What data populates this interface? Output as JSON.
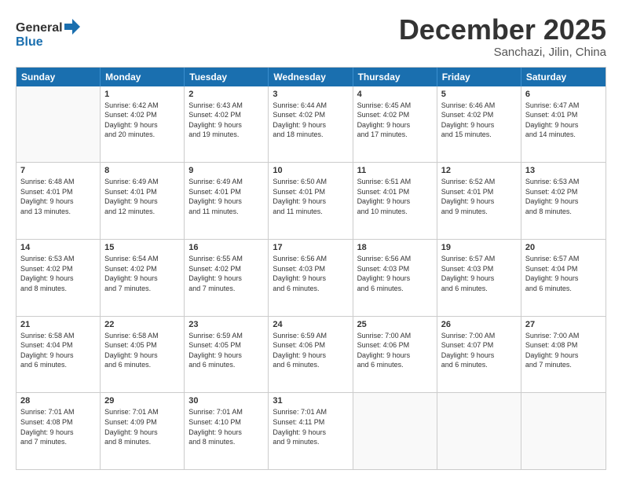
{
  "logo": {
    "line1": "General",
    "line2": "Blue"
  },
  "title": "December 2025",
  "location": "Sanchazi, Jilin, China",
  "days_of_week": [
    "Sunday",
    "Monday",
    "Tuesday",
    "Wednesday",
    "Thursday",
    "Friday",
    "Saturday"
  ],
  "weeks": [
    [
      {
        "day": "",
        "lines": []
      },
      {
        "day": "1",
        "lines": [
          "Sunrise: 6:42 AM",
          "Sunset: 4:02 PM",
          "Daylight: 9 hours",
          "and 20 minutes."
        ]
      },
      {
        "day": "2",
        "lines": [
          "Sunrise: 6:43 AM",
          "Sunset: 4:02 PM",
          "Daylight: 9 hours",
          "and 19 minutes."
        ]
      },
      {
        "day": "3",
        "lines": [
          "Sunrise: 6:44 AM",
          "Sunset: 4:02 PM",
          "Daylight: 9 hours",
          "and 18 minutes."
        ]
      },
      {
        "day": "4",
        "lines": [
          "Sunrise: 6:45 AM",
          "Sunset: 4:02 PM",
          "Daylight: 9 hours",
          "and 17 minutes."
        ]
      },
      {
        "day": "5",
        "lines": [
          "Sunrise: 6:46 AM",
          "Sunset: 4:02 PM",
          "Daylight: 9 hours",
          "and 15 minutes."
        ]
      },
      {
        "day": "6",
        "lines": [
          "Sunrise: 6:47 AM",
          "Sunset: 4:01 PM",
          "Daylight: 9 hours",
          "and 14 minutes."
        ]
      }
    ],
    [
      {
        "day": "7",
        "lines": [
          "Sunrise: 6:48 AM",
          "Sunset: 4:01 PM",
          "Daylight: 9 hours",
          "and 13 minutes."
        ]
      },
      {
        "day": "8",
        "lines": [
          "Sunrise: 6:49 AM",
          "Sunset: 4:01 PM",
          "Daylight: 9 hours",
          "and 12 minutes."
        ]
      },
      {
        "day": "9",
        "lines": [
          "Sunrise: 6:49 AM",
          "Sunset: 4:01 PM",
          "Daylight: 9 hours",
          "and 11 minutes."
        ]
      },
      {
        "day": "10",
        "lines": [
          "Sunrise: 6:50 AM",
          "Sunset: 4:01 PM",
          "Daylight: 9 hours",
          "and 11 minutes."
        ]
      },
      {
        "day": "11",
        "lines": [
          "Sunrise: 6:51 AM",
          "Sunset: 4:01 PM",
          "Daylight: 9 hours",
          "and 10 minutes."
        ]
      },
      {
        "day": "12",
        "lines": [
          "Sunrise: 6:52 AM",
          "Sunset: 4:01 PM",
          "Daylight: 9 hours",
          "and 9 minutes."
        ]
      },
      {
        "day": "13",
        "lines": [
          "Sunrise: 6:53 AM",
          "Sunset: 4:02 PM",
          "Daylight: 9 hours",
          "and 8 minutes."
        ]
      }
    ],
    [
      {
        "day": "14",
        "lines": [
          "Sunrise: 6:53 AM",
          "Sunset: 4:02 PM",
          "Daylight: 9 hours",
          "and 8 minutes."
        ]
      },
      {
        "day": "15",
        "lines": [
          "Sunrise: 6:54 AM",
          "Sunset: 4:02 PM",
          "Daylight: 9 hours",
          "and 7 minutes."
        ]
      },
      {
        "day": "16",
        "lines": [
          "Sunrise: 6:55 AM",
          "Sunset: 4:02 PM",
          "Daylight: 9 hours",
          "and 7 minutes."
        ]
      },
      {
        "day": "17",
        "lines": [
          "Sunrise: 6:56 AM",
          "Sunset: 4:03 PM",
          "Daylight: 9 hours",
          "and 6 minutes."
        ]
      },
      {
        "day": "18",
        "lines": [
          "Sunrise: 6:56 AM",
          "Sunset: 4:03 PM",
          "Daylight: 9 hours",
          "and 6 minutes."
        ]
      },
      {
        "day": "19",
        "lines": [
          "Sunrise: 6:57 AM",
          "Sunset: 4:03 PM",
          "Daylight: 9 hours",
          "and 6 minutes."
        ]
      },
      {
        "day": "20",
        "lines": [
          "Sunrise: 6:57 AM",
          "Sunset: 4:04 PM",
          "Daylight: 9 hours",
          "and 6 minutes."
        ]
      }
    ],
    [
      {
        "day": "21",
        "lines": [
          "Sunrise: 6:58 AM",
          "Sunset: 4:04 PM",
          "Daylight: 9 hours",
          "and 6 minutes."
        ]
      },
      {
        "day": "22",
        "lines": [
          "Sunrise: 6:58 AM",
          "Sunset: 4:05 PM",
          "Daylight: 9 hours",
          "and 6 minutes."
        ]
      },
      {
        "day": "23",
        "lines": [
          "Sunrise: 6:59 AM",
          "Sunset: 4:05 PM",
          "Daylight: 9 hours",
          "and 6 minutes."
        ]
      },
      {
        "day": "24",
        "lines": [
          "Sunrise: 6:59 AM",
          "Sunset: 4:06 PM",
          "Daylight: 9 hours",
          "and 6 minutes."
        ]
      },
      {
        "day": "25",
        "lines": [
          "Sunrise: 7:00 AM",
          "Sunset: 4:06 PM",
          "Daylight: 9 hours",
          "and 6 minutes."
        ]
      },
      {
        "day": "26",
        "lines": [
          "Sunrise: 7:00 AM",
          "Sunset: 4:07 PM",
          "Daylight: 9 hours",
          "and 6 minutes."
        ]
      },
      {
        "day": "27",
        "lines": [
          "Sunrise: 7:00 AM",
          "Sunset: 4:08 PM",
          "Daylight: 9 hours",
          "and 7 minutes."
        ]
      }
    ],
    [
      {
        "day": "28",
        "lines": [
          "Sunrise: 7:01 AM",
          "Sunset: 4:08 PM",
          "Daylight: 9 hours",
          "and 7 minutes."
        ]
      },
      {
        "day": "29",
        "lines": [
          "Sunrise: 7:01 AM",
          "Sunset: 4:09 PM",
          "Daylight: 9 hours",
          "and 8 minutes."
        ]
      },
      {
        "day": "30",
        "lines": [
          "Sunrise: 7:01 AM",
          "Sunset: 4:10 PM",
          "Daylight: 9 hours",
          "and 8 minutes."
        ]
      },
      {
        "day": "31",
        "lines": [
          "Sunrise: 7:01 AM",
          "Sunset: 4:11 PM",
          "Daylight: 9 hours",
          "and 9 minutes."
        ]
      },
      {
        "day": "",
        "lines": []
      },
      {
        "day": "",
        "lines": []
      },
      {
        "day": "",
        "lines": []
      }
    ]
  ]
}
